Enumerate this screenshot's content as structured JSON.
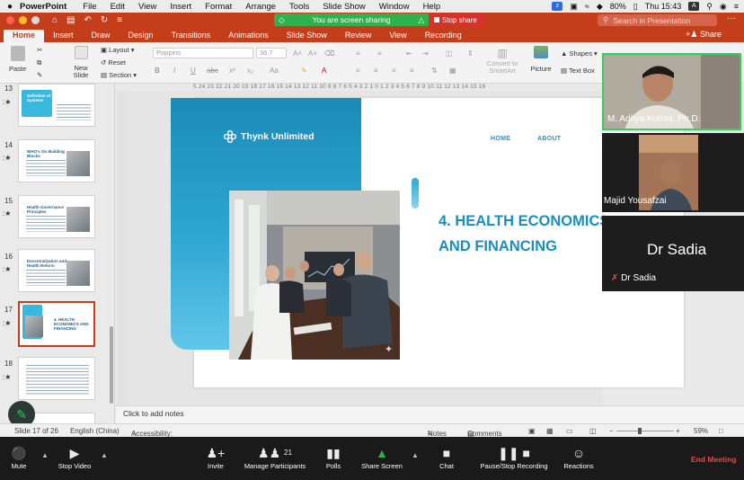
{
  "menubar": {
    "apple": "",
    "app": "PowerPoint",
    "items": [
      "File",
      "Edit",
      "View",
      "Insert",
      "Format",
      "Arrange",
      "Tools",
      "Slide Show",
      "Window",
      "Help"
    ],
    "battery": "80%",
    "clock": "Thu 15:43",
    "input_source": "A"
  },
  "titlebar": {
    "sharing_status": "You are screen sharing",
    "stop_share": "Stop share",
    "search_placeholder": "Search in Presentation"
  },
  "ribbon_tabs": [
    "Home",
    "Insert",
    "Draw",
    "Design",
    "Transitions",
    "Animations",
    "Slide Show",
    "Review",
    "View",
    "Recording"
  ],
  "active_tab": "Home",
  "share_label": "Share",
  "ribbon": {
    "paste": "Paste",
    "new_slide": "New Slide",
    "layout": "Layout",
    "reset": "Reset",
    "section": "Section",
    "font_name": "Poppins",
    "font_size": "36.7",
    "convert_smartart": "Convert to SmartArt",
    "picture": "Picture",
    "shapes": "Shapes",
    "text_box": "Text Box"
  },
  "ruler_text": "5  24  23  22  21  20  19  18  17  16  15  14  13  12  11  10  9  8  7  6  5  4  3  2  1  0  1  2  3  4  5  6  7  8  9  10  11  12  13  14  15  16",
  "thumbnails": [
    {
      "num": "13",
      "title": "Definition of Health Systems"
    },
    {
      "num": "14",
      "title": "WHO's Six Building Blocks"
    },
    {
      "num": "15",
      "title": "Health Governance Principles"
    },
    {
      "num": "16",
      "title": "Decentralization and Health Reform"
    },
    {
      "num": "17",
      "title": "4. HEALTH ECONOMICS AND FINANCING"
    },
    {
      "num": "18",
      "title": ""
    }
  ],
  "slide": {
    "brand": "Thynk Unlimited",
    "nav_home": "HOME",
    "nav_about": "ABOUT",
    "title_line1": "4. HEALTH ECONOMICS",
    "title_line2": "AND FINANCING"
  },
  "notes_placeholder": "Click to add notes",
  "status": {
    "slide_info": "Slide 17 of 26",
    "language": "English (China)",
    "accessibility": "Accessibility: Investigate",
    "notes": "Notes",
    "comments": "Comments",
    "zoom": "59%"
  },
  "participants": [
    {
      "name": "M. Aditya Kurnia, Ph.D."
    },
    {
      "name": "Majid Yousafzai"
    },
    {
      "name": "Dr Sadia",
      "display": "Dr Sadia"
    }
  ],
  "zoom_toolbar": {
    "mute": "Mute",
    "stop_video": "Stop Video",
    "invite": "Invite",
    "manage_participants": "Manage Participants",
    "participant_count": "21",
    "polls": "Polls",
    "share_screen": "Share Screen",
    "chat": "Chat",
    "pause_recording": "Pause/Stop Recording",
    "reactions": "Reactions",
    "end_meeting": "End Meeting"
  },
  "colors": {
    "powerpoint_red": "#c43e1c",
    "slide_blue": "#1a8fbf",
    "share_green": "#2fb24c",
    "stop_red": "#d9302c",
    "active_speaker": "#2fd25a"
  }
}
